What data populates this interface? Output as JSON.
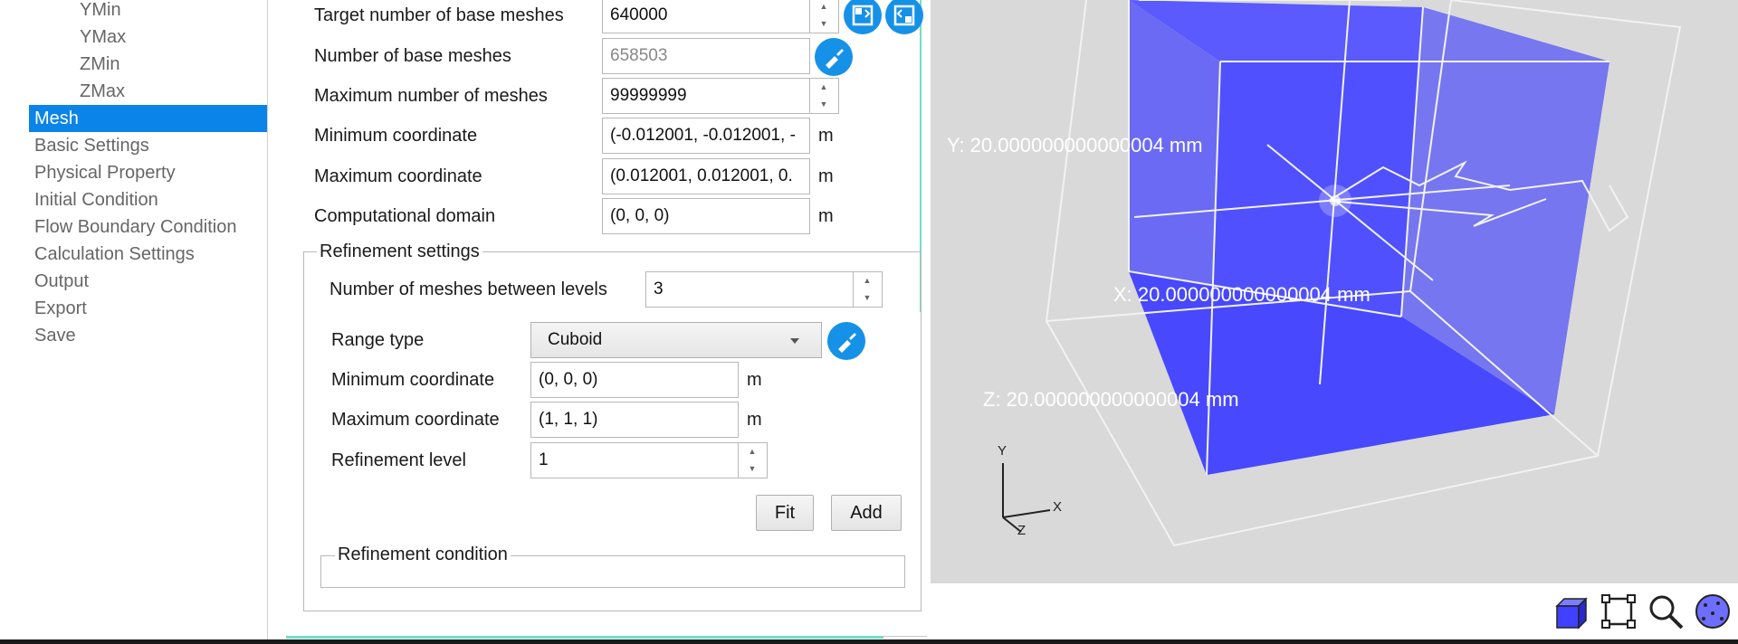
{
  "tree": {
    "sub_items": [
      "YMin",
      "YMax",
      "ZMin",
      "ZMax"
    ],
    "items": [
      "Mesh",
      "Basic Settings",
      "Physical Property",
      "Initial Condition",
      "Flow Boundary Condition",
      "Calculation Settings",
      "Output",
      "Export",
      "Save"
    ],
    "selected": "Mesh"
  },
  "mesh": {
    "target_base_label": "Target number of base meshes",
    "target_base_value": "640000",
    "num_base_label": "Number of base meshes",
    "num_base_value": "658503",
    "max_meshes_label": "Maximum number of meshes",
    "max_meshes_value": "99999999",
    "min_coord_label": "Minimum coordinate",
    "min_coord_value": "(-0.012001, -0.012001, -",
    "max_coord_label": "Maximum coordinate",
    "max_coord_value": "(0.012001, 0.012001, 0.",
    "domain_label": "Computational domain",
    "domain_value": "(0, 0, 0)",
    "unit": "m"
  },
  "refinement": {
    "title": "Refinement settings",
    "between_levels_label": "Number of meshes between levels",
    "between_levels_value": "3",
    "range_type_label": "Range type",
    "range_type_value": "Cuboid",
    "min_coord_label": "Minimum coordinate",
    "min_coord_value": "(0, 0, 0)",
    "max_coord_label": "Maximum coordinate",
    "max_coord_value": "(1, 1, 1)",
    "level_label": "Refinement level",
    "level_value": "1",
    "fit_label": "Fit",
    "add_label": "Add",
    "unit": "m",
    "condition_title": "Refinement condition"
  },
  "viewport": {
    "y_dim": "Y: 20.000000000000004 mm",
    "x_dim": "X: 20.000000000000004 mm",
    "z_dim": "Z: 20.000000000000004 mm",
    "axis_y": "Y",
    "axis_x": "X",
    "axis_z": "Z",
    "background": "#d9d9d9",
    "box_color": "#4a4aff"
  },
  "icons": {
    "target_actions": [
      "layout-left-icon",
      "layout-right-icon"
    ],
    "num_base_action": "brush-icon",
    "range_action": "brush-icon",
    "toolbar": [
      "cube-icon",
      "fit-frame-icon",
      "zoom-icon",
      "mesh-sphere-icon"
    ]
  }
}
